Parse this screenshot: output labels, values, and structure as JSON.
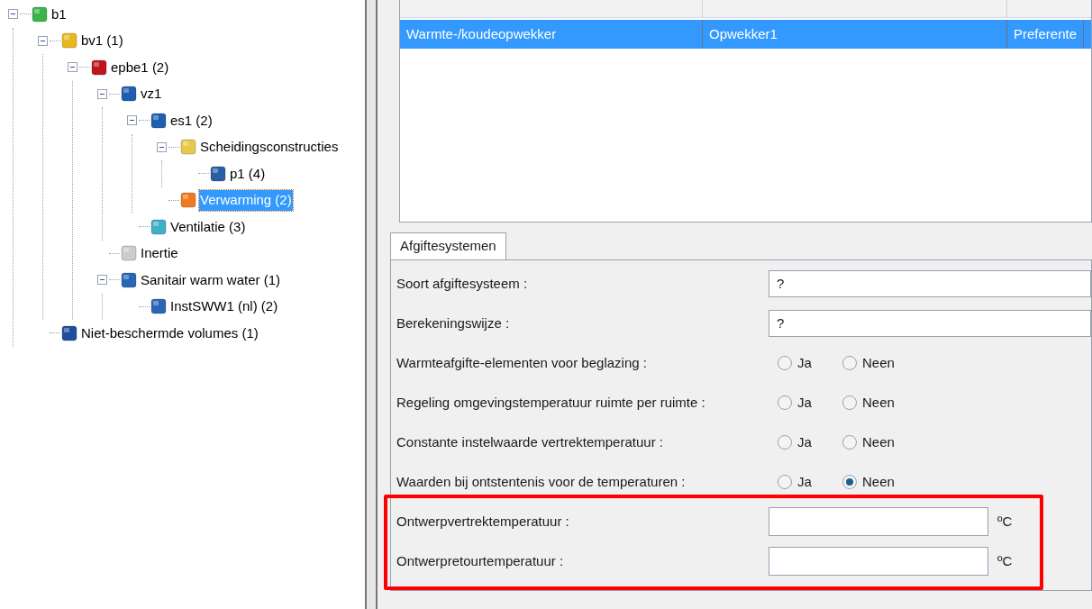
{
  "tree": [
    {
      "label": "b1",
      "expanded": true,
      "selected": false,
      "children": [
        {
          "label": "bv1 (1)",
          "expanded": true,
          "selected": false,
          "children": [
            {
              "label": "epbe1 (2)",
              "expanded": true,
              "selected": false,
              "children": [
                {
                  "label": "vz1",
                  "expanded": true,
                  "selected": false,
                  "children": [
                    {
                      "label": "es1 (2)",
                      "expanded": true,
                      "selected": false,
                      "children": [
                        {
                          "label": "Scheidingsconstructies",
                          "expanded": true,
                          "selected": false,
                          "children": [
                            {
                              "label": "p1 (4)",
                              "selected": false
                            }
                          ]
                        },
                        {
                          "label": "Verwarming (2)",
                          "selected": true
                        }
                      ]
                    },
                    {
                      "label": "Ventilatie (3)",
                      "selected": false
                    }
                  ]
                },
                {
                  "label": "Inertie",
                  "selected": false
                },
                {
                  "label": "Sanitair warm water (1)",
                  "expanded": true,
                  "selected": false,
                  "children": [
                    {
                      "label": "InstSWW1 (nl) (2)",
                      "selected": false
                    }
                  ]
                }
              ]
            }
          ]
        },
        {
          "label": "Niet-beschermde volumes (1)",
          "selected": false
        }
      ]
    }
  ],
  "table": {
    "rows": [
      {
        "selected": true,
        "cells": [
          "Warmte-/koudeopwekker",
          "Opwekker1",
          "Preferente"
        ]
      }
    ]
  },
  "tabs": [
    {
      "label": "Afgiftesystemen",
      "selected": true
    }
  ],
  "form": [
    {
      "kind": "select",
      "label": "Soort afgiftesysteem :",
      "value": "?"
    },
    {
      "kind": "select",
      "label": "Berekeningswijze :",
      "value": "?"
    },
    {
      "kind": "radio",
      "label": "Warmteafgifte-elementen voor beglazing :",
      "options": [
        {
          "label": "Ja",
          "selected": false
        },
        {
          "label": "Neen",
          "selected": false
        }
      ]
    },
    {
      "kind": "radio",
      "label": "Regeling omgevingstemperatuur ruimte per ruimte :",
      "options": [
        {
          "label": "Ja",
          "selected": false
        },
        {
          "label": "Neen",
          "selected": false
        }
      ]
    },
    {
      "kind": "radio",
      "label": "Constante instelwaarde vertrektemperatuur :",
      "options": [
        {
          "label": "Ja",
          "selected": false
        },
        {
          "label": "Neen",
          "selected": false
        }
      ]
    },
    {
      "kind": "radio",
      "label": "Waarden bij ontstentenis voor de temperaturen :",
      "options": [
        {
          "label": "Ja",
          "selected": false
        },
        {
          "label": "Neen",
          "selected": true
        }
      ]
    },
    {
      "kind": "unit",
      "label": "Ontwerpvertrektemperatuur :",
      "unit": "ºC",
      "highlighted": true
    },
    {
      "kind": "unit",
      "label": "Ontwerpretourtemperatuur :",
      "unit": "ºC",
      "highlighted": true
    }
  ]
}
